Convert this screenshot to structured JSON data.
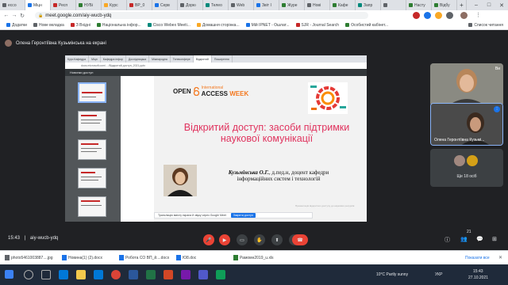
{
  "browser": {
    "tabs": [
      {
        "label": "ессо",
        "color": "#5f6368"
      },
      {
        "label": "Мiцн",
        "color": "#1a73e8"
      },
      {
        "label": "Респ",
        "color": "#c62828"
      },
      {
        "label": "НУБі",
        "color": "#2e7d32"
      },
      {
        "label": "Курс",
        "color": "#f9a825"
      },
      {
        "label": "ВР_0",
        "color": "#c62828"
      },
      {
        "label": "Серв",
        "color": "#1a73e8"
      },
      {
        "label": "Дорю",
        "color": "#5f6368"
      },
      {
        "label": "Телео",
        "color": "#00897b"
      },
      {
        "label": "Web",
        "color": "#5f6368"
      },
      {
        "label": "Звіт I",
        "color": "#1a73e8"
      },
      {
        "label": "Журе",
        "color": "#2e7d32"
      },
      {
        "label": "Нові",
        "color": "#5f6368"
      },
      {
        "label": "Кафе",
        "color": "#2e7d32"
      },
      {
        "label": "Запр",
        "color": "#00897b"
      },
      {
        "label": "",
        "color": "#5f6368"
      },
      {
        "label": "Насту",
        "color": "#2e7d32"
      },
      {
        "label": "Відбу",
        "color": "#2e7d32"
      }
    ],
    "url": "meet.google.com/aiy-wucb-ydq",
    "bookmarks": [
      "Додатки",
      "Нове вкладка",
      "З Вхідні",
      "Національна інфор...",
      "Cisco Webex Meeti...",
      "Домашня сторінка...",
      "Мій IPNET - Ошлат...",
      "SJR - Journal Search",
      "Особистий кабінет...",
      "Список читання"
    ]
  },
  "meet": {
    "presenter_banner": "Олена Геронтіївна Кузьмінська на екрані",
    "shared_screen": {
      "inner_tabs": [
        "Курс Кафедрa",
        "Мiцн",
        "Кафедра інфор",
        "Дослідницька",
        "Міжнародна",
        "Телеконфере",
        "Відкритий",
        "Поширення"
      ],
      "inner_url": "docs.microsoft.com/…/Відкритий доступ_2021.pptx",
      "viewer_title": "Новинки доступ",
      "slide": {
        "oa_open": "OPEN",
        "oa_international": "International",
        "oa_access": "ACCESS",
        "oa_week": "WEEK",
        "title": "Відкритий доступ: засоби підтримки наукової комунікації",
        "author_name": "Кузьмінська О.Г.",
        "author_rest": ", д.пед.н, доцент кафедри інформаційних систем і технологій",
        "small_note": "Презентація відкритого доступу до наукових ресурсів"
      },
      "share_bar_text": "Трансляцію вмісту екрана й звуку через Google Meet",
      "share_bar_button": "Закрити доступ"
    },
    "tiles": [
      {
        "name": "Ви"
      },
      {
        "name": "Олена Геронтіївна Кузьмі..."
      }
    ],
    "others_label": "Ще 18 осіб",
    "time": "15:43",
    "meeting_code": "aiy-wucb-ydq",
    "participants_count": "21"
  },
  "downloads": {
    "items": [
      {
        "name": "photo5461003887....jpg",
        "color": "#5f6368"
      },
      {
        "name": "Новина(1) (2).docx",
        "color": "#1a73e8"
      },
      {
        "name": "Робота СО ВП_й....docx",
        "color": "#1a73e8"
      },
      {
        "name": "Ю8.doc",
        "color": "#1a73e8"
      },
      {
        "name": "Рамомн2019_u.xls",
        "color": "#2e7d32"
      }
    ],
    "show_all": "Показати все"
  },
  "taskbar": {
    "weather": "10°C  Partly sunny",
    "lang": "УКР",
    "time": "15:43",
    "date": "27.10.2021"
  }
}
